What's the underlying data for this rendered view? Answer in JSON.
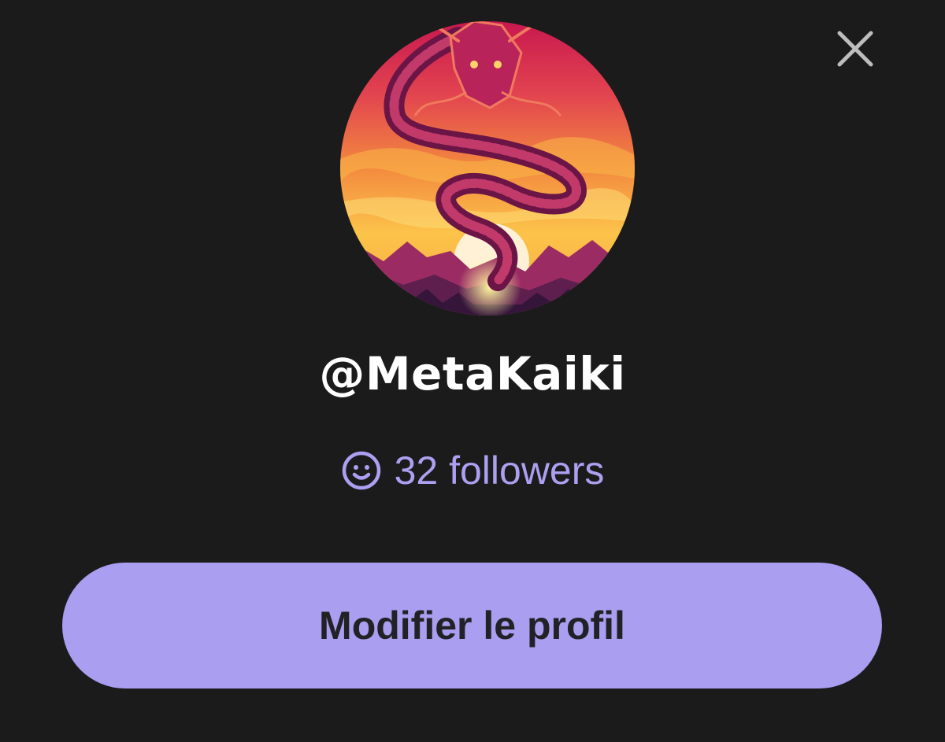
{
  "close": {
    "icon": "close-icon",
    "color": "#bdbdbd"
  },
  "profile": {
    "avatar_icon": "dragon-sunset-avatar",
    "username": "@MetaKaiki",
    "followers_icon": "smiley-icon",
    "followers_text": "32 followers"
  },
  "actions": {
    "edit_profile_label": "Modifier le profil"
  },
  "colors": {
    "background": "#1b1b1c",
    "accent": "#aa9ef0",
    "followers_text": "#aca0f0",
    "username_text": "#ffffff",
    "button_text": "#222125"
  }
}
